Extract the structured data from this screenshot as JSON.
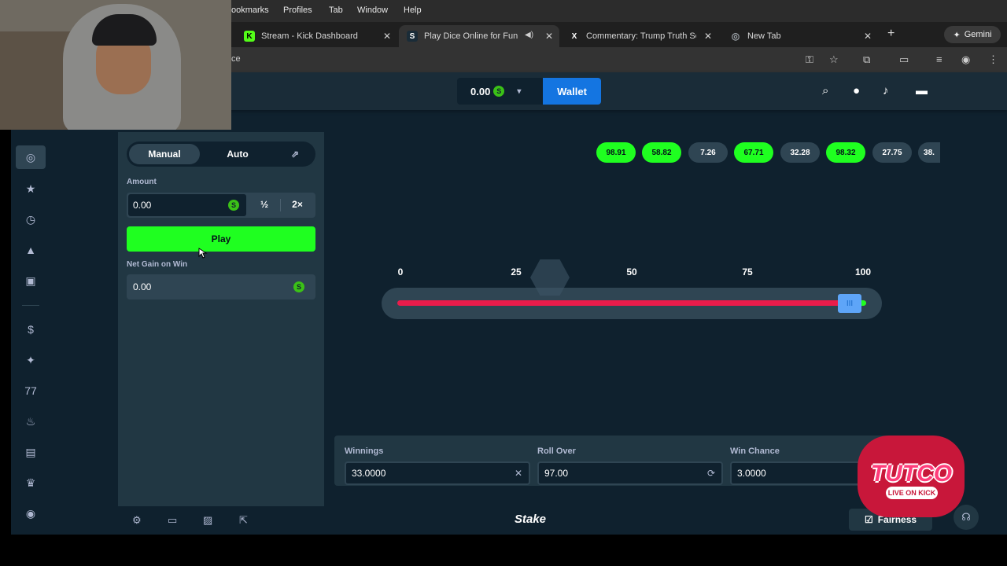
{
  "menubar": {
    "items": [
      "ookmarks",
      "Profiles",
      "Tab",
      "Window",
      "Help"
    ]
  },
  "tabs": [
    {
      "title": "Stream - Kick Dashboard",
      "icon": "K",
      "icon_color": "#53fc18"
    },
    {
      "title": "Play Dice Online for Fun &",
      "icon": "S",
      "icon_color": "#ffffff"
    },
    {
      "title": "Commentary: Trump Truth So",
      "icon": "X",
      "icon_color": "#ffffff"
    },
    {
      "title": "New Tab",
      "icon": "◎",
      "icon_color": "#9aa0a6"
    }
  ],
  "browser": {
    "url_fragment": "ce",
    "gemini_label": "Gemini"
  },
  "topnav": {
    "balance": "0.00",
    "currency_symbol": "S",
    "wallet_label": "Wallet"
  },
  "controls": {
    "mode_manual": "Manual",
    "mode_auto": "Auto",
    "amount_label": "Amount",
    "amount_value": "0.00",
    "half_label": "½",
    "double_label": "2×",
    "play_label": "Play",
    "net_gain_label": "Net Gain on Win",
    "net_gain_value": "0.00"
  },
  "results": [
    {
      "value": "98.91",
      "win": true
    },
    {
      "value": "58.82",
      "win": true
    },
    {
      "value": "7.26",
      "win": false
    },
    {
      "value": "67.71",
      "win": true
    },
    {
      "value": "32.28",
      "win": false
    },
    {
      "value": "98.32",
      "win": true
    },
    {
      "value": "27.75",
      "win": false
    },
    {
      "value": "38.",
      "win": false
    }
  ],
  "slider": {
    "ticks": [
      "0",
      "25",
      "50",
      "75",
      "100"
    ],
    "roll_over": 97,
    "handle_glyph": "III"
  },
  "stats": {
    "winnings_label": "Winnings",
    "winnings_value": "33.0000",
    "roll_over_label": "Roll Over",
    "roll_over_value": "97.00",
    "win_chance_label": "Win Chance",
    "win_chance_value": "3.0000"
  },
  "bottombar": {
    "logo": "Stake",
    "fairness_label": "Fairness"
  },
  "overlay": {
    "brand": "TUTCO",
    "tagline": "LIVE ON KICK"
  },
  "colors": {
    "accent_green": "#1fff20",
    "wallet_blue": "#1475e1",
    "lose_red": "#ea1c4b",
    "bg": "#0f212e",
    "panel": "#213743"
  }
}
